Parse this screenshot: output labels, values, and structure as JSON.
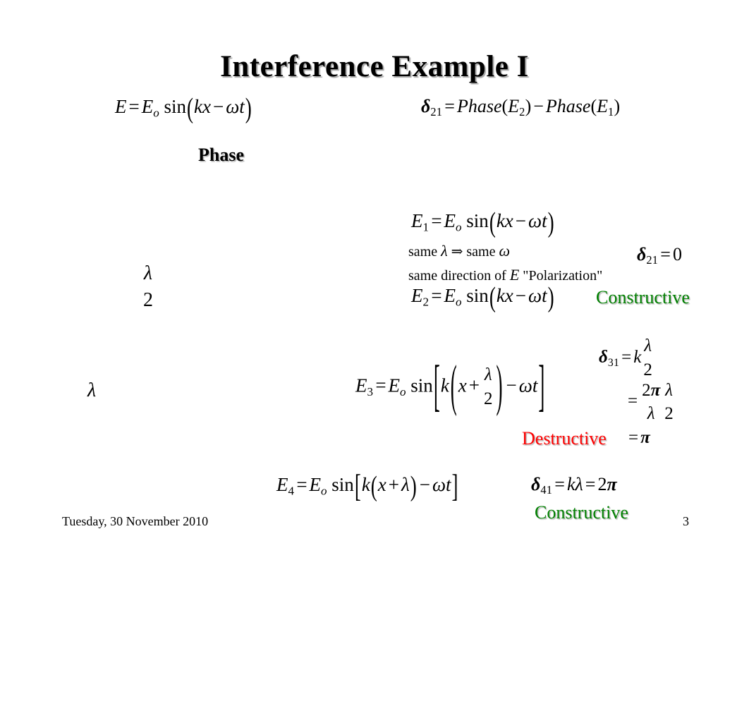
{
  "slide": {
    "title": "Interference Example I",
    "page_number": "3",
    "date": "Tuesday, 30 November 2010",
    "colors": {
      "constructive": "#008000",
      "destructive": "#FF0000",
      "text": "#000000",
      "background": "#FFFFFF"
    }
  },
  "top": {
    "wave_equation": "E = E_o sin(kx - ωt)",
    "phase_definition": "δ_21 = Phase(E_2) - Phase(E_1)",
    "phase_label": "Phase"
  },
  "left_annotations": [
    {
      "id": "half-lambda",
      "numerator": "λ",
      "denominator": "2"
    },
    {
      "id": "full-lambda",
      "value": "λ"
    }
  ],
  "cases": [
    {
      "id": "case-1-2",
      "equation_1": "E_1 = E_o sin(kx - ωt)",
      "note_1": "same λ ⇒ same ω",
      "note_2": "same direction of E \"Polarization\"",
      "equation_2": "E_2 = E_o sin(kx - ωt)",
      "delta_label": "δ_21 = 0",
      "verdict": "Constructive"
    },
    {
      "id": "case-3",
      "equation": "E_3 = E_o sin[ k( x + λ/2 ) - ωt ]",
      "delta_line_1": "δ_31 = k λ/2",
      "delta_line_2": "= (2π/λ)(λ/2)",
      "delta_line_3": "= π",
      "verdict": "Destructive"
    },
    {
      "id": "case-4",
      "equation": "E_4 = E_o sin[ k( x + λ ) - ωt ]",
      "delta_label": "δ_41 = kλ = 2π",
      "verdict": "Constructive"
    }
  ],
  "symbols": {
    "E": "E",
    "E_sub_o": "o",
    "sin": "sin",
    "k": "k",
    "x": "x",
    "t": "t",
    "omega": "ω",
    "lambda": "λ",
    "pi": "π",
    "delta": "δ",
    "equals": "=",
    "minus": "−",
    "plus": "+",
    "implies": "⇒",
    "zero": "0",
    "two": "2",
    "one": "1",
    "three": "3",
    "four": "4",
    "twentyone": "21",
    "thirtyone": "31",
    "fortyone": "41",
    "paren_open": "(",
    "paren_close": ")",
    "brack_open": "[",
    "brack_close": "]",
    "Phase": "Phase",
    "same": "same",
    "same_direction_of": "same direction of",
    "polarization": "\"Polarization\""
  }
}
